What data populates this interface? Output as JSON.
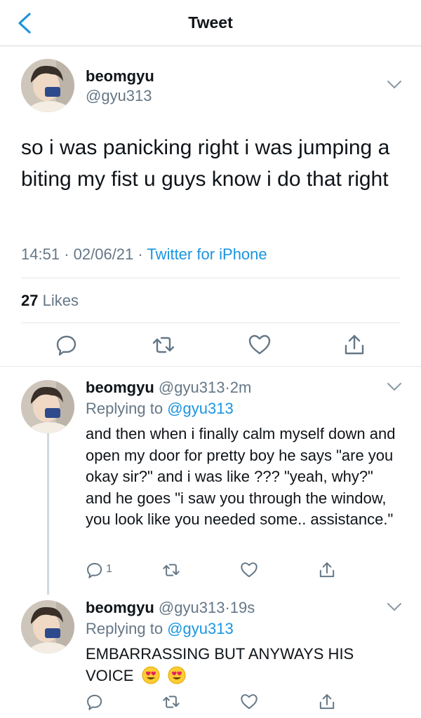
{
  "header": {
    "title": "Tweet"
  },
  "main_tweet": {
    "name": "beomgyu",
    "handle": "@gyu313",
    "text": "so i was panicking right i was jumping a biting my fist u guys know i do that right",
    "time": "14:51",
    "date": "02/06/21",
    "source": "Twitter for iPhone",
    "likes_count": "27",
    "likes_label": "Likes"
  },
  "replies": [
    {
      "name": "beomgyu",
      "handle": "@gyu313",
      "time": "2m",
      "replying_label": "Replying to",
      "replying_to": "@gyu313",
      "text": "and then when i finally calm myself down and open my door for pretty boy he says \"are you okay sir?\" and i was like ??? \"yeah, why?\" and he goes \"i saw you through the window, you look like you needed some.. assistance.\"",
      "reply_count": "1"
    },
    {
      "name": "beomgyu",
      "handle": "@gyu313",
      "time": "19s",
      "replying_label": "Replying to",
      "replying_to": "@gyu313",
      "text": "EMBARRASSING BUT ANYWAYS HIS VOICE",
      "emojis": [
        "heart-eyes-emoji",
        "heart-eyes-emoji"
      ]
    }
  ],
  "colors": {
    "accent": "#1b95e0",
    "secondary_text": "#657786",
    "divider": "#e1e8ed"
  }
}
